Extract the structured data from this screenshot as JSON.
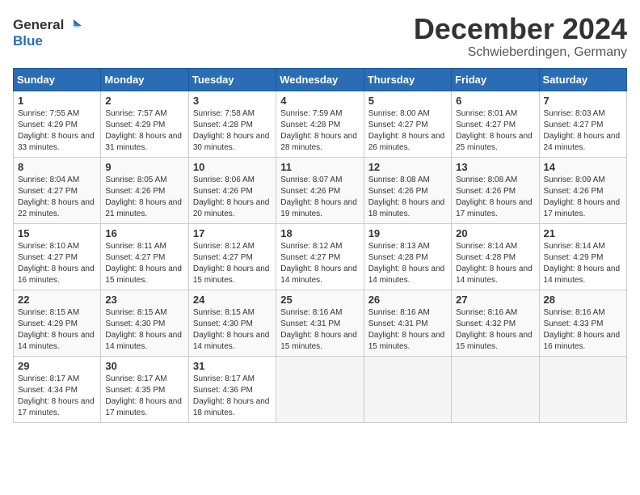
{
  "logo": {
    "general": "General",
    "blue": "Blue"
  },
  "title": {
    "month": "December 2024",
    "location": "Schwieberdingen, Germany"
  },
  "headers": [
    "Sunday",
    "Monday",
    "Tuesday",
    "Wednesday",
    "Thursday",
    "Friday",
    "Saturday"
  ],
  "weeks": [
    [
      {
        "day": "1",
        "sunrise": "7:55 AM",
        "sunset": "4:29 PM",
        "daylight": "8 hours and 33 minutes."
      },
      {
        "day": "2",
        "sunrise": "7:57 AM",
        "sunset": "4:29 PM",
        "daylight": "8 hours and 31 minutes."
      },
      {
        "day": "3",
        "sunrise": "7:58 AM",
        "sunset": "4:28 PM",
        "daylight": "8 hours and 30 minutes."
      },
      {
        "day": "4",
        "sunrise": "7:59 AM",
        "sunset": "4:28 PM",
        "daylight": "8 hours and 28 minutes."
      },
      {
        "day": "5",
        "sunrise": "8:00 AM",
        "sunset": "4:27 PM",
        "daylight": "8 hours and 26 minutes."
      },
      {
        "day": "6",
        "sunrise": "8:01 AM",
        "sunset": "4:27 PM",
        "daylight": "8 hours and 25 minutes."
      },
      {
        "day": "7",
        "sunrise": "8:03 AM",
        "sunset": "4:27 PM",
        "daylight": "8 hours and 24 minutes."
      }
    ],
    [
      {
        "day": "8",
        "sunrise": "8:04 AM",
        "sunset": "4:27 PM",
        "daylight": "8 hours and 22 minutes."
      },
      {
        "day": "9",
        "sunrise": "8:05 AM",
        "sunset": "4:26 PM",
        "daylight": "8 hours and 21 minutes."
      },
      {
        "day": "10",
        "sunrise": "8:06 AM",
        "sunset": "4:26 PM",
        "daylight": "8 hours and 20 minutes."
      },
      {
        "day": "11",
        "sunrise": "8:07 AM",
        "sunset": "4:26 PM",
        "daylight": "8 hours and 19 minutes."
      },
      {
        "day": "12",
        "sunrise": "8:08 AM",
        "sunset": "4:26 PM",
        "daylight": "8 hours and 18 minutes."
      },
      {
        "day": "13",
        "sunrise": "8:08 AM",
        "sunset": "4:26 PM",
        "daylight": "8 hours and 17 minutes."
      },
      {
        "day": "14",
        "sunrise": "8:09 AM",
        "sunset": "4:26 PM",
        "daylight": "8 hours and 17 minutes."
      }
    ],
    [
      {
        "day": "15",
        "sunrise": "8:10 AM",
        "sunset": "4:27 PM",
        "daylight": "8 hours and 16 minutes."
      },
      {
        "day": "16",
        "sunrise": "8:11 AM",
        "sunset": "4:27 PM",
        "daylight": "8 hours and 15 minutes."
      },
      {
        "day": "17",
        "sunrise": "8:12 AM",
        "sunset": "4:27 PM",
        "daylight": "8 hours and 15 minutes."
      },
      {
        "day": "18",
        "sunrise": "8:12 AM",
        "sunset": "4:27 PM",
        "daylight": "8 hours and 14 minutes."
      },
      {
        "day": "19",
        "sunrise": "8:13 AM",
        "sunset": "4:28 PM",
        "daylight": "8 hours and 14 minutes."
      },
      {
        "day": "20",
        "sunrise": "8:14 AM",
        "sunset": "4:28 PM",
        "daylight": "8 hours and 14 minutes."
      },
      {
        "day": "21",
        "sunrise": "8:14 AM",
        "sunset": "4:29 PM",
        "daylight": "8 hours and 14 minutes."
      }
    ],
    [
      {
        "day": "22",
        "sunrise": "8:15 AM",
        "sunset": "4:29 PM",
        "daylight": "8 hours and 14 minutes."
      },
      {
        "day": "23",
        "sunrise": "8:15 AM",
        "sunset": "4:30 PM",
        "daylight": "8 hours and 14 minutes."
      },
      {
        "day": "24",
        "sunrise": "8:15 AM",
        "sunset": "4:30 PM",
        "daylight": "8 hours and 14 minutes."
      },
      {
        "day": "25",
        "sunrise": "8:16 AM",
        "sunset": "4:31 PM",
        "daylight": "8 hours and 15 minutes."
      },
      {
        "day": "26",
        "sunrise": "8:16 AM",
        "sunset": "4:31 PM",
        "daylight": "8 hours and 15 minutes."
      },
      {
        "day": "27",
        "sunrise": "8:16 AM",
        "sunset": "4:32 PM",
        "daylight": "8 hours and 15 minutes."
      },
      {
        "day": "28",
        "sunrise": "8:16 AM",
        "sunset": "4:33 PM",
        "daylight": "8 hours and 16 minutes."
      }
    ],
    [
      {
        "day": "29",
        "sunrise": "8:17 AM",
        "sunset": "4:34 PM",
        "daylight": "8 hours and 17 minutes."
      },
      {
        "day": "30",
        "sunrise": "8:17 AM",
        "sunset": "4:35 PM",
        "daylight": "8 hours and 17 minutes."
      },
      {
        "day": "31",
        "sunrise": "8:17 AM",
        "sunset": "4:36 PM",
        "daylight": "8 hours and 18 minutes."
      },
      null,
      null,
      null,
      null
    ]
  ]
}
